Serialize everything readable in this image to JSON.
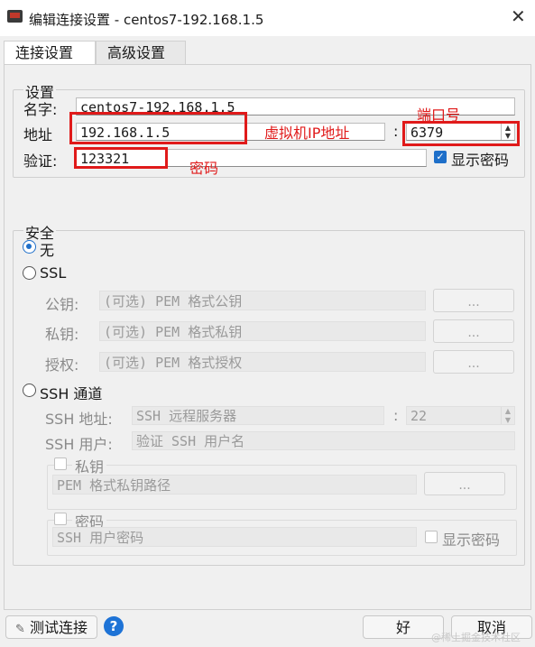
{
  "window": {
    "title": "编辑连接设置 - centos7-192.168.1.5",
    "close_glyph": "✕"
  },
  "tabs": [
    {
      "label": "连接设置",
      "active": true
    },
    {
      "label": "高级设置",
      "active": false
    }
  ],
  "settings": {
    "group_title": "设置",
    "name_label": "名字:",
    "name_value": "centos7-192.168.1.5",
    "address_label": "地址",
    "address_value": "192.168.1.5",
    "port_sep": ":",
    "port_value": "6379",
    "auth_label": "验证:",
    "auth_value": "123321",
    "show_password_label": "显示密码",
    "show_password_checked": true
  },
  "annotations": {
    "vm_ip": "虚拟机IP地址",
    "port": "端口号",
    "password": "密码",
    "color": "#e01a1a"
  },
  "security": {
    "group_title": "安全",
    "opt_none": "无",
    "opt_ssl": "SSL",
    "public_key_label": "公钥:",
    "public_key_placeholder": "(可选) PEM 格式公钥",
    "private_key_label": "私钥:",
    "private_key_placeholder": "(可选) PEM 格式私钥",
    "authority_label": "授权:",
    "authority_placeholder": "(可选) PEM 格式授权",
    "browse_label": "...",
    "opt_ssh": "SSH 通道",
    "ssh_address_label": "SSH 地址:",
    "ssh_address_placeholder": "SSH 远程服务器",
    "ssh_port_sep": ":",
    "ssh_port_value": "22",
    "ssh_user_label": "SSH 用户:",
    "ssh_user_placeholder": "验证 SSH 用户名",
    "private_key_group": "私钥",
    "pem_path_placeholder": "PEM 格式私钥路径",
    "password_group": "密码",
    "ssh_password_placeholder": "SSH 用户密码",
    "ssh_show_password": "显示密码"
  },
  "footer": {
    "test_connection": "测试连接",
    "help": "?",
    "ok": "好",
    "cancel": "取消",
    "watermark": "@稀土掘金技术社区"
  }
}
